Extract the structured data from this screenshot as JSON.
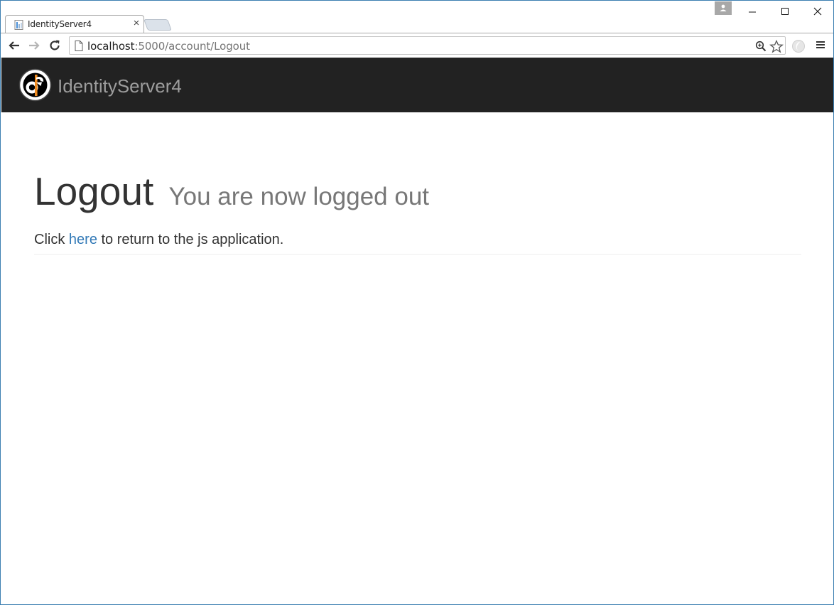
{
  "browser": {
    "tab": {
      "title": "IdentityServer4",
      "close_glyph": "×",
      "favicon": "page-favicon-icon"
    },
    "window_controls": {
      "minimize": "–",
      "maximize": "☐",
      "close": "✕"
    },
    "address_bar": {
      "host": "localhost",
      "path": ":5000/account/Logout"
    },
    "icons": {
      "back": "back-arrow-icon",
      "forward": "forward-arrow-icon",
      "reload": "reload-icon",
      "zoom": "zoom-icon",
      "bookmark": "star-icon",
      "extension": "extension-icon",
      "menu": "hamburger-menu-icon",
      "profile": "profile-icon"
    }
  },
  "navbar": {
    "brand": "IdentityServer4",
    "background": "#222222",
    "brand_color": "#9d9d9d"
  },
  "page": {
    "title": "Logout",
    "subtitle": "You are now logged out",
    "message_prefix": "Click",
    "link_text": "here",
    "message_suffix": "to return to the js application."
  },
  "colors": {
    "link": "#337ab7",
    "text": "#333333",
    "muted": "#777777",
    "window_border": "#3c7fb1"
  }
}
